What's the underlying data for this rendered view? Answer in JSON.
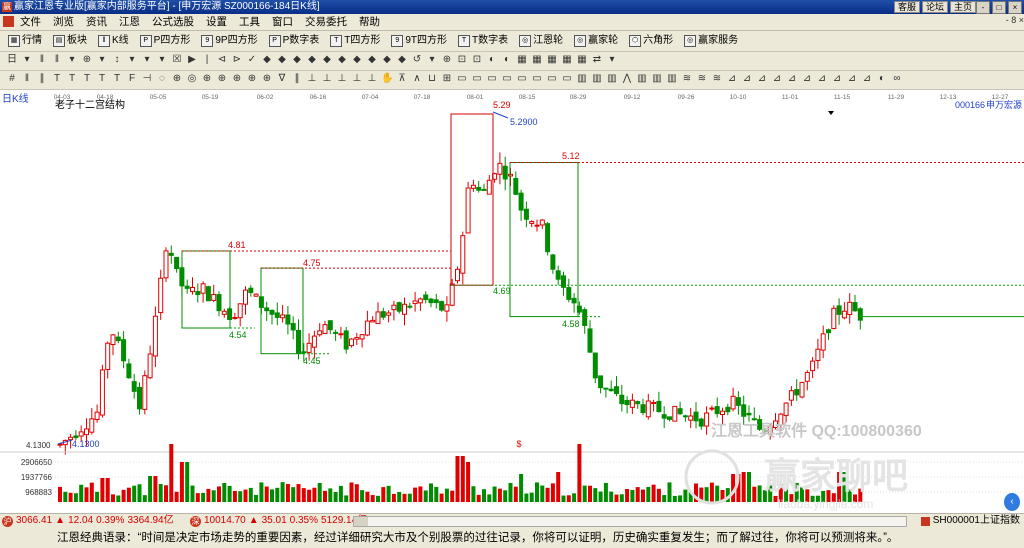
{
  "window": {
    "app_icon": "赢",
    "title": "赢家江恩专业版[赢家内部服务平台] - [申万宏源   SZ000166-184日K线]",
    "links": [
      "客服",
      "论坛",
      "主页"
    ],
    "buttons": [
      "-",
      "□",
      "×"
    ]
  },
  "menu": {
    "items": [
      "文件",
      "浏览",
      "资讯",
      "江恩",
      "公式选股",
      "设置",
      "工具",
      "窗口",
      "交易委托",
      "帮助"
    ],
    "right_label": "- 8 ×"
  },
  "toolbar1": {
    "items": [
      {
        "icon": "grid-icon",
        "glyph": "▦",
        "label": "行情"
      },
      {
        "icon": "block-icon",
        "glyph": "▤",
        "label": "板块"
      },
      {
        "icon": "kline-icon",
        "glyph": "‖",
        "label": "K线"
      },
      {
        "icon": "square-p-icon",
        "glyph": "P",
        "label": "P四方形"
      },
      {
        "icon": "square-9p-icon",
        "glyph": "9",
        "label": "9P四方形"
      },
      {
        "icon": "square-pn-icon",
        "glyph": "P",
        "label": "P数字表"
      },
      {
        "icon": "square-t-icon",
        "glyph": "T",
        "label": "T四方形"
      },
      {
        "icon": "square-9t-icon",
        "glyph": "9",
        "label": "9T四方形"
      },
      {
        "icon": "square-tn-icon",
        "glyph": "T",
        "label": "T数字表"
      },
      {
        "icon": "wheel-icon",
        "glyph": "◎",
        "label": "江恩轮"
      },
      {
        "icon": "wheel2-icon",
        "glyph": "◎",
        "label": "赢家轮"
      },
      {
        "icon": "hexagon-icon",
        "glyph": "⬡",
        "label": "六角形"
      },
      {
        "icon": "service-icon",
        "glyph": "◎",
        "label": "赢家服务"
      }
    ]
  },
  "toolbar2_icons": [
    "日",
    "▾",
    "‖",
    "‖",
    "▾",
    "⊕",
    "▾",
    "↕",
    "▾",
    "▾",
    "▾",
    "☒",
    "▶",
    "|",
    "⊲",
    "⊳",
    "✓",
    "◆",
    "◆",
    "◆",
    "◆",
    "◆",
    "◆",
    "◆",
    "◆",
    "◆",
    "◆",
    "↺",
    "▾",
    "⊕",
    "⊡",
    "⊡",
    "◐",
    "◐",
    "▦",
    "▦",
    "▦",
    "▦",
    "▦",
    "⇄",
    "▾"
  ],
  "toolbar3_icons": [
    "#",
    "‖",
    "∥",
    "T",
    "T",
    "T",
    "T",
    "T",
    "F",
    "⊣",
    "◌",
    "⊕",
    "◎",
    "⊕",
    "⊕",
    "⊕",
    "⊕",
    "⊕",
    "∇",
    "∥",
    "⊥",
    "⊥",
    "⊥",
    "⊥",
    "⊥",
    "✋",
    "⊼",
    "∧",
    "⊔",
    "⊞",
    "▭",
    "▭",
    "▭",
    "▭",
    "▭",
    "▭",
    "▭",
    "▭",
    "▥",
    "▥",
    "▥",
    "⋀",
    "▥",
    "▥",
    "▥",
    "≋",
    "≋",
    "≋",
    "⊿",
    "⊿",
    "⊿",
    "⊿",
    "⊿",
    "⊿",
    "⊿",
    "⊿",
    "⊿",
    "⊿",
    "◐",
    "∞"
  ],
  "chart": {
    "period_label": "日K线",
    "structure_label": "老子十二宫结构",
    "stock_code": "000166",
    "stock_name": "申万宏源",
    "date_ticks": [
      "04-03",
      "04-18",
      "05-05",
      "05-19",
      "06-02",
      "06-16",
      "07-04",
      "07-18",
      "08-01",
      "08-15",
      "08-29",
      "09-12",
      "09-26",
      "10-10",
      "11-01",
      "11-15",
      "11-29",
      "12-13",
      "12-27"
    ],
    "price_marks": [
      "5.29",
      "5.2900",
      "5.12",
      "4.81",
      "4.75",
      "4.69",
      "4.58",
      "4.54",
      "4.45",
      "4.1300",
      "4.1300"
    ],
    "volume_ticks": [
      "2906650",
      "1937766",
      "968883"
    ],
    "dollar_mark": "$",
    "watermark": "江恩工具软件  QQ:100800360",
    "watermark2": "赢家聊吧",
    "watermark3": "liaoba.yingjia.com",
    "colors": {
      "up": "#e00000",
      "down": "#008c00",
      "box_red": "#d40000",
      "box_green": "#009000",
      "dash_red": "#e00000",
      "dash_green": "#00a000",
      "blue": "#1f3fc8"
    }
  },
  "status": {
    "sh_badge": "沪",
    "sh_index": "3066.41",
    "sh_change": "12.04",
    "sh_pct": "0.39%",
    "sh_amount": "3364.94亿",
    "sz_badge": "深",
    "sz_index": "10014.70",
    "sz_change": "35.01",
    "sz_pct": "0.35%",
    "sz_amount": "5129.14亿",
    "ticker": "SH000001上证指数"
  },
  "quote": {
    "text": "江恩经典语录：“时间是决定市场走势的重要因素，经过详细研究大市及个别股票的过往记录，你将可以证明，历史确实重复发生；而了解过往，你将可以预测将来。”。"
  }
}
